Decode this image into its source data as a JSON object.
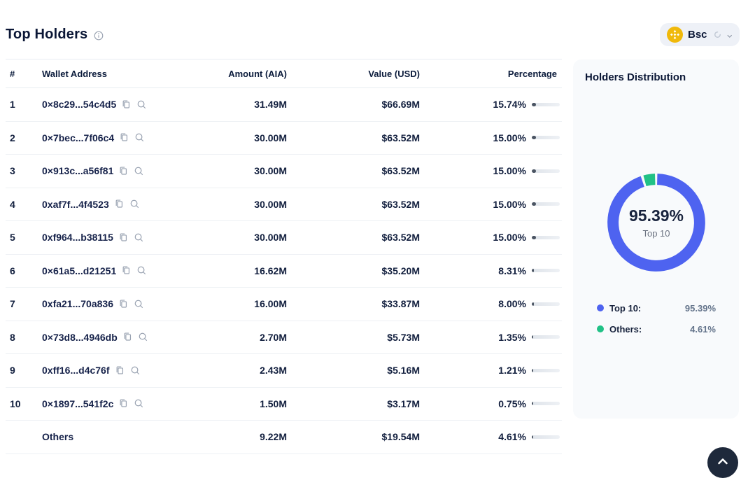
{
  "header": {
    "title": "Top Holders",
    "chain_selector": {
      "label": "Bsc"
    }
  },
  "table": {
    "columns": [
      "#",
      "Wallet Address",
      "Amount (AIA)",
      "Value (USD)",
      "Percentage"
    ],
    "rows": [
      {
        "rank": "1",
        "address": "0×8c29...54c4d5",
        "icons": true,
        "amount": "31.49M",
        "value": "$66.69M",
        "percentage": "15.74%",
        "pct": 15.74
      },
      {
        "rank": "2",
        "address": "0×7bec...7f06c4",
        "icons": true,
        "amount": "30.00M",
        "value": "$63.52M",
        "percentage": "15.00%",
        "pct": 15.0
      },
      {
        "rank": "3",
        "address": "0×913c...a56f81",
        "icons": true,
        "amount": "30.00M",
        "value": "$63.52M",
        "percentage": "15.00%",
        "pct": 15.0
      },
      {
        "rank": "4",
        "address": "0xaf7f...4f4523",
        "icons": true,
        "amount": "30.00M",
        "value": "$63.52M",
        "percentage": "15.00%",
        "pct": 15.0
      },
      {
        "rank": "5",
        "address": "0xf964...b38115",
        "icons": true,
        "amount": "30.00M",
        "value": "$63.52M",
        "percentage": "15.00%",
        "pct": 15.0
      },
      {
        "rank": "6",
        "address": "0×61a5...d21251",
        "icons": true,
        "amount": "16.62M",
        "value": "$35.20M",
        "percentage": "8.31%",
        "pct": 8.31
      },
      {
        "rank": "7",
        "address": "0xfa21...70a836",
        "icons": true,
        "amount": "16.00M",
        "value": "$33.87M",
        "percentage": "8.00%",
        "pct": 8.0
      },
      {
        "rank": "8",
        "address": "0×73d8...4946db",
        "icons": true,
        "amount": "2.70M",
        "value": "$5.73M",
        "percentage": "1.35%",
        "pct": 1.35
      },
      {
        "rank": "9",
        "address": "0xff16...d4c76f",
        "icons": true,
        "amount": "2.43M",
        "value": "$5.16M",
        "percentage": "1.21%",
        "pct": 1.21
      },
      {
        "rank": "10",
        "address": "0×1897...541f2c",
        "icons": true,
        "amount": "1.50M",
        "value": "$3.17M",
        "percentage": "0.75%",
        "pct": 0.75
      },
      {
        "rank": "",
        "address": "Others",
        "icons": false,
        "amount": "9.22M",
        "value": "$19.54M",
        "percentage": "4.61%",
        "pct": 4.61
      }
    ]
  },
  "distribution": {
    "title": "Holders Distribution",
    "center_value": "95.39%",
    "center_label": "Top 10",
    "legend": [
      {
        "label": "Top 10:",
        "value": "95.39%",
        "color": "#4e63f0"
      },
      {
        "label": "Others:",
        "value": "4.61%",
        "color": "#21c186"
      }
    ]
  },
  "chart_data": {
    "type": "pie",
    "labels": [
      "Top 10",
      "Others"
    ],
    "values": [
      95.39,
      4.61
    ],
    "colors": [
      "#4e63f0",
      "#21c186"
    ],
    "title": "Holders Distribution",
    "center_value": "95.39%",
    "center_label": "Top 10",
    "legend_position": "bottom"
  }
}
